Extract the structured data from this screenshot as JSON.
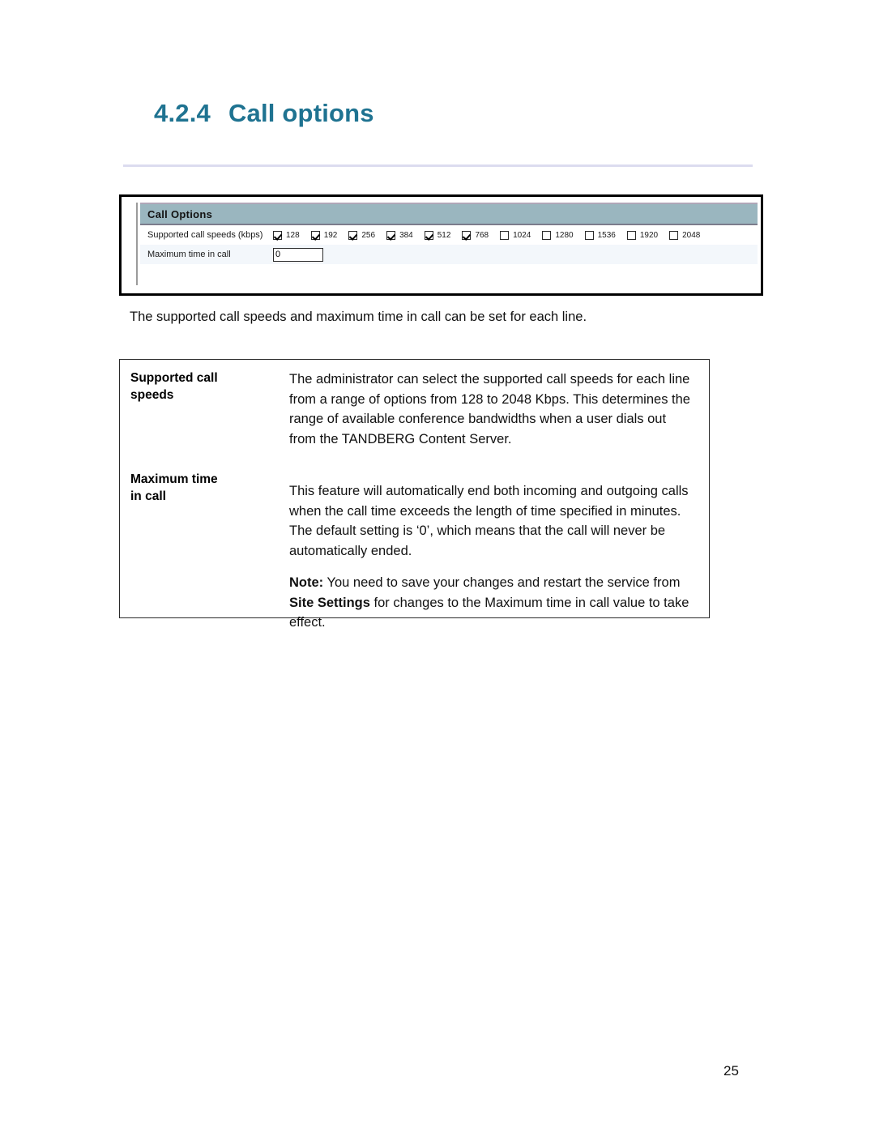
{
  "heading": {
    "number": "4.2.4",
    "title": "Call options"
  },
  "panel": {
    "header_title": "Call Options",
    "speeds_label": "Supported call speeds (kbps)",
    "max_time_label": "Maximum time in call",
    "max_time_value": "0",
    "max_time_placeholder": "",
    "header_bg_color": "#9ab6bf",
    "alt_row_bg_color": "#f3f7fb",
    "speeds": [
      {
        "label": "128",
        "checked": true
      },
      {
        "label": "192",
        "checked": true
      },
      {
        "label": "256",
        "checked": true
      },
      {
        "label": "384",
        "checked": true
      },
      {
        "label": "512",
        "checked": true
      },
      {
        "label": "768",
        "checked": true
      },
      {
        "label": "1024",
        "checked": false
      },
      {
        "label": "1280",
        "checked": false
      },
      {
        "label": "1536",
        "checked": false
      },
      {
        "label": "1920",
        "checked": false
      },
      {
        "label": "2048",
        "checked": false
      }
    ]
  },
  "caption": "The supported call speeds and maximum time in call can be set for each line.",
  "definitions": [
    {
      "term_line1": "Supported call",
      "term_line2": "speeds",
      "description": "The administrator can select the supported call speeds for each line from a range of options from 128 to 2048 Kbps. This determines the range of available conference bandwidths when a user dials out from the TANDBERG Content Server."
    },
    {
      "term_line1": "Maximum time",
      "term_line2": "in call",
      "description": "This feature will automatically end both incoming and outgoing calls when the call time exceeds the length of time specified in minutes. The default setting is ‘0’, which means that the call will never be automatically ended."
    }
  ],
  "note": {
    "label": "Note:",
    "part1": " You need to save your changes and restart the service from ",
    "bold_ref": "Site Settings",
    "part2": " for changes to the Maximum time in call value to take effect."
  },
  "page_number": "25",
  "colors": {
    "heading": "#1f7391",
    "rule": "#dcdcef"
  }
}
